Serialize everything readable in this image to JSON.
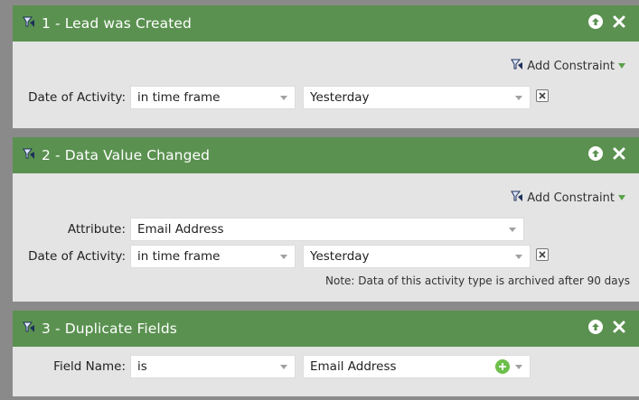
{
  "filters": [
    {
      "title": "1 - Lead was Created",
      "add_constraint": "Add Constraint",
      "rows": [
        {
          "label": "Date of Activity:",
          "operator": "in time frame",
          "value": "Yesterday"
        }
      ]
    },
    {
      "title": "2 - Data Value Changed",
      "add_constraint": "Add Constraint",
      "rows": [
        {
          "label": "Attribute:",
          "value": "Email Address"
        },
        {
          "label": "Date of Activity:",
          "operator": "in time frame",
          "value": "Yesterday"
        }
      ],
      "note": "Note: Data of this activity type is archived after 90 days"
    },
    {
      "title": "3 - Duplicate Fields",
      "rows": [
        {
          "label": "Field Name:",
          "operator": "is",
          "value": "Email Address"
        }
      ]
    }
  ],
  "colors": {
    "header_green": "#5a9150",
    "panel_bg": "#e4e4e4",
    "page_bg": "#8a8a8a",
    "add_green": "#6cbf4a"
  }
}
